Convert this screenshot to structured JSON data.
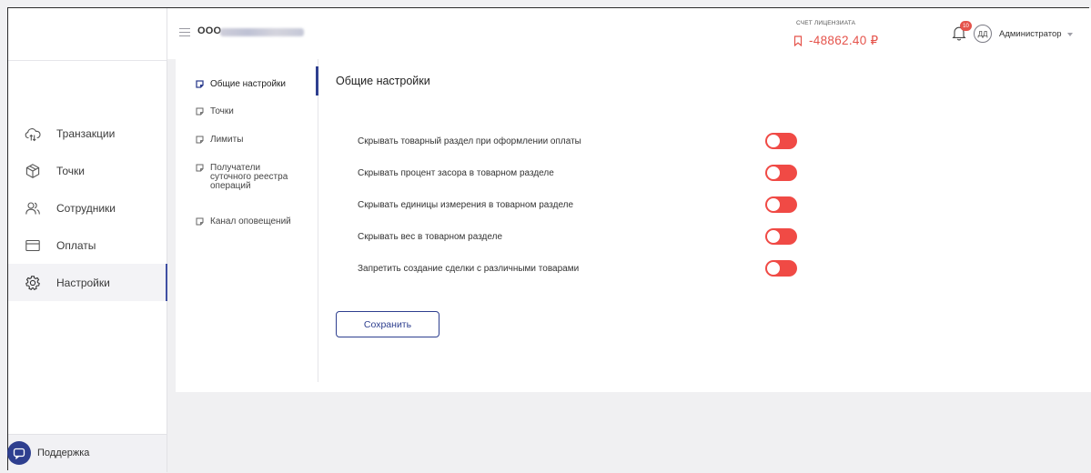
{
  "header": {
    "company_prefix": "ООО",
    "account_label": "СЧЕТ ЛИЦЕНЗИАТА",
    "account_value": "-48862.40 ₽",
    "notification_count": "10",
    "avatar_initials": "ДД",
    "user_role": "Администратор"
  },
  "sidebar": {
    "items": [
      {
        "label": "Транзакции",
        "icon": "cloud-transfer-icon"
      },
      {
        "label": "Точки",
        "icon": "box-icon"
      },
      {
        "label": "Сотрудники",
        "icon": "users-icon"
      },
      {
        "label": "Оплаты",
        "icon": "card-icon"
      },
      {
        "label": "Настройки",
        "icon": "gear-icon"
      }
    ],
    "active": "Настройки",
    "support_label": "Поддержка"
  },
  "settings_nav": {
    "items": [
      {
        "label": "Общие настройки"
      },
      {
        "label": "Точки"
      },
      {
        "label": "Лимиты"
      },
      {
        "label": "Получатели суточного реестра операций"
      },
      {
        "label": "Канал оповещений"
      }
    ],
    "active": "Общие настройки"
  },
  "main": {
    "title": "Общие настройки",
    "settings": [
      {
        "label": "Скрывать товарный раздел при оформлении оплаты",
        "enabled": false
      },
      {
        "label": "Скрывать процент засора в товарном разделе",
        "enabled": false
      },
      {
        "label": "Скрывать единицы измерения в товарном разделе",
        "enabled": false
      },
      {
        "label": "Скрывать вес в товарном разделе",
        "enabled": false
      },
      {
        "label": "Запретить создание сделки с различными товарами",
        "enabled": false
      }
    ],
    "save_label": "Сохранить"
  },
  "colors": {
    "accent": "#2e3f8f",
    "toggle_off": "#f04a45",
    "balance": "#e5534b"
  }
}
